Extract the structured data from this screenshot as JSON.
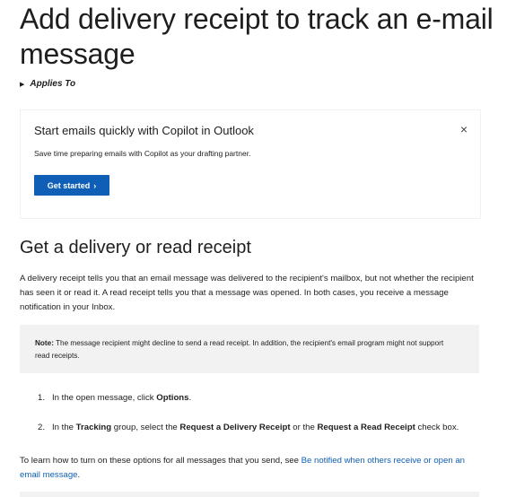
{
  "article": {
    "title": "Add delivery receipt to track an e-mail message",
    "applies_to": "Applies To"
  },
  "banner": {
    "title": "Start emails quickly with Copilot in Outlook",
    "subtitle": "Save time preparing emails with Copilot as your drafting partner.",
    "button_label": "Get started",
    "button_chevron": "›",
    "close_glyph": "×"
  },
  "section": {
    "heading": "Get a delivery or read receipt",
    "intro": "A delivery receipt tells you that an email message was delivered to the recipient's mailbox, but not whether the recipient has seen it or read it. A read receipt tells you that a message was opened. In both cases, you receive a message notification in your Inbox.",
    "note_label": "Note:",
    "note_text": " The message recipient might decline to send a read receipt. In addition, the recipient's email program might not support read receipts.",
    "steps": [
      {
        "num": "1.",
        "pre": "In the open message, click ",
        "b1": "Options",
        "post": "."
      },
      {
        "num": "2.",
        "pre": "In the ",
        "b1": "Tracking",
        "mid1": " group, select the ",
        "b2": "Request a Delivery Receipt",
        "mid2": " or the ",
        "b3": "Request a Read Receipt",
        "post": " check box."
      }
    ],
    "outro_text": "To learn how to turn on these options for all messages that you send, see ",
    "outro_link": "Be notified when others receive or open an email message",
    "outro_end": "."
  },
  "colors": {
    "accent": "#0f5fb7",
    "note_bg": "#f2f2f2",
    "text": "#1e1e1e"
  }
}
